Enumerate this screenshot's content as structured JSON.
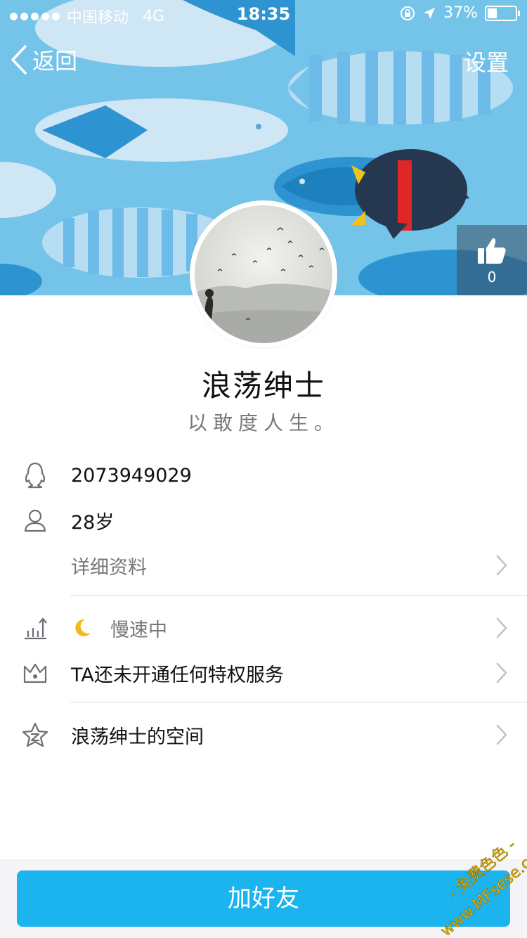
{
  "status_bar": {
    "carrier": "中国移动",
    "network": "4G",
    "time": "18:35",
    "battery_text": "37%",
    "battery_level": 0.37
  },
  "nav": {
    "back_label": "返回",
    "settings_label": "设置"
  },
  "likes": {
    "count": "0"
  },
  "profile": {
    "nickname": "浪荡绅士",
    "signature": "以敢度人生。"
  },
  "info": {
    "qq_number": "2073949029",
    "age": "28岁",
    "details_label": "详细资料",
    "level_status": "慢速中",
    "privilege_text": "TA还未开通任何特权服务",
    "qzone_label": "浪荡绅士的空间"
  },
  "actions": {
    "add_friend_label": "加好友"
  },
  "watermark": {
    "line1": "- 免费色色 -",
    "line2": "www.MFsese.com"
  },
  "colors": {
    "header_bg": "#74c4ea",
    "primary_button": "#1cb4ee",
    "watermark": "#f5c400"
  },
  "icons": {
    "back": "chevron-left-icon",
    "like": "thumbs-up-icon",
    "qq": "qq-penguin-icon",
    "person": "person-icon",
    "level": "level-chart-icon",
    "moon": "moon-icon",
    "crown": "crown-icon",
    "star": "star-space-icon",
    "chevron": "chevron-right-icon"
  }
}
